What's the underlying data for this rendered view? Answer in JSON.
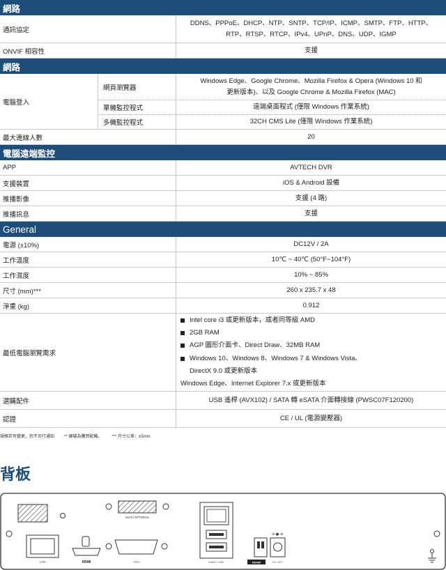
{
  "sections": {
    "network": "網路",
    "network2": "網路",
    "remote": "電腦遠端監控",
    "general": "General"
  },
  "network": {
    "protocol_label": "通訊協定",
    "protocol_line1": "DDNS、PPPoE、DHCP、NTP、SNTP、TCP/IP、ICMP、SMTP、FTP、HTTP、",
    "protocol_line2": "RTP、RTSP、RTCP、IPv4、UPnP、DNS、UDP、IGMP",
    "onvif_label": "ONVIF 相容性",
    "onvif_value": "支援"
  },
  "login": {
    "label": "電腦登入",
    "browser_label": "網頁瀏覽器",
    "browser_line1": "Windows Edge、Google Chrome、Mozilla Firefox & Opera (Windows 10 和",
    "browser_line2": "更新版本)、以及 Google Chrome & Mozilla Firefox (MAC)",
    "single_label": "單機監控程式",
    "single_value": "遠端桌面程式 (僅限 Windows 作業系統)",
    "multi_label": "多機監控程式",
    "multi_value": "32CH CMS Lite (僅限 Windows 作業系統)",
    "max_label": "最大連線人數",
    "max_value": "20"
  },
  "remote": {
    "app_label": "APP",
    "app_value": "AVTECH DVR",
    "device_label": "支援裝置",
    "device_value": "iOS & Android 設備",
    "push_video_label": "推播影像",
    "push_video_value": "支援 (4 路)",
    "push_msg_label": "推播訊息",
    "push_msg_value": "支援"
  },
  "general": {
    "power_label": "電源 (±10%)",
    "power_value": "DC12V / 2A",
    "temp_label": "工作溫度",
    "temp_value": "10℃ ~ 40℃ (50°F~104°F)",
    "humidity_label": "工作濕度",
    "humidity_value": "10% ~ 85%",
    "size_label": "尺寸 (mm)***",
    "size_value": "260 x 235.7 x 48",
    "weight_label": "淨重 (kg)",
    "weight_value": "0.912",
    "req_label": "最低電腦瀏覽需求",
    "req_items": [
      "Intel core i3 或更新版本，或者同等級 AMD",
      "2GB RAM",
      "AGP 圖形介面卡、Direct Draw、32MB RAM",
      "Windows 10、Windows 8、Windows 7 & Windows Vista、"
    ],
    "req_cont": "DirectX 9.0 或更新版本",
    "req_tail": "Windows Edge、Internet Explorer 7.x 或更新版本",
    "acc_label": "選購配件",
    "acc_value": "USB 遙桿 (AVX102) / SATA 轉 eSATA 介面轉接線 (PWSC07F120200)",
    "cert_label": "認證",
    "cert_value": "CE / UL (電源變壓器)"
  },
  "notes": {
    "n1": "規格若有變更，恕不另行通知",
    "n2": "** 硬碟為購買配備。",
    "n3": "*** 尺寸公差：±5mm"
  },
  "back_panel": {
    "title": "背板",
    "esata": "eSATA OPTIONAL",
    "lan": "LAN",
    "hdmi": "HDMI",
    "vga": "VGA",
    "iman_usb": "IMAN / USB",
    "rs485": "RS485",
    "dc": "DC 12V",
    "dc_symbol": "⊖-●-⊕"
  }
}
